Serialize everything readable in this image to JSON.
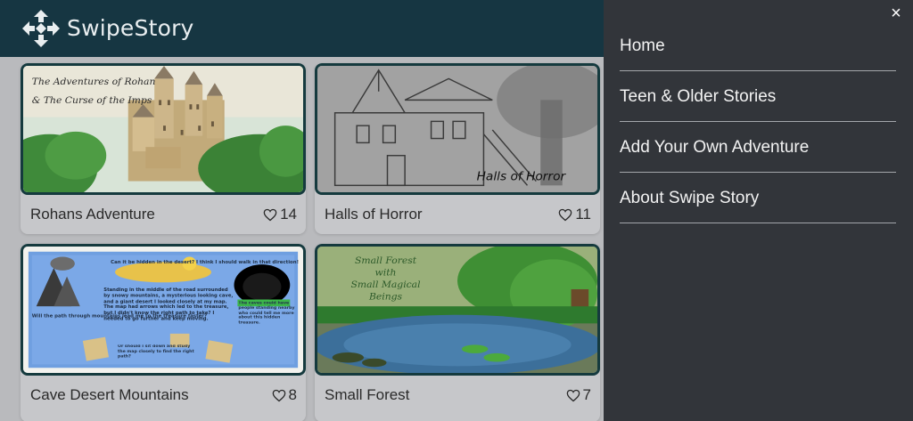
{
  "app": {
    "brand": "SwipeStory",
    "logo_icon": "move-arrows-logo-icon"
  },
  "theme": {
    "header_bg": "#163642",
    "drawer_bg": "#32353a",
    "card_border": "#153a3e"
  },
  "stories": [
    {
      "title": "Rohans Adventure",
      "likes": "14",
      "cover_text": [
        "The Adventures of Rohan",
        "& The Curse of the Imps"
      ]
    },
    {
      "title": "Halls of Horror",
      "likes": "11",
      "cover_text": [
        "Halls of Horror"
      ]
    },
    {
      "title": "Cave Desert Mountains",
      "likes": "8",
      "cover_text": [
        "Will the path through mountains lead me to the treasure faster?",
        "Can it be hidden in the desert? I think I should walk in that direction!",
        "Standing in the middle of the road surrounded by snowy mountains, a mysterious looking cave, and a giant desert I looked closely at my map. The map had arrows which led to the treasure, but I didn't know the right path to take? I needed to go further and keep moving.",
        "The caves could have people standing nearby who could tell me more about this hidden treasure.",
        "Or should I sit down and study the map closely to find the right path?"
      ]
    },
    {
      "title": "Small Forest",
      "likes": "7",
      "cover_text": [
        "Small Forest",
        "with",
        "Small Magical",
        "Beings"
      ]
    }
  ],
  "drawer": {
    "close_symbol": "×",
    "items": [
      "Home",
      "Teen & Older Stories",
      "Add Your Own Adventure",
      "About Swipe Story"
    ]
  }
}
